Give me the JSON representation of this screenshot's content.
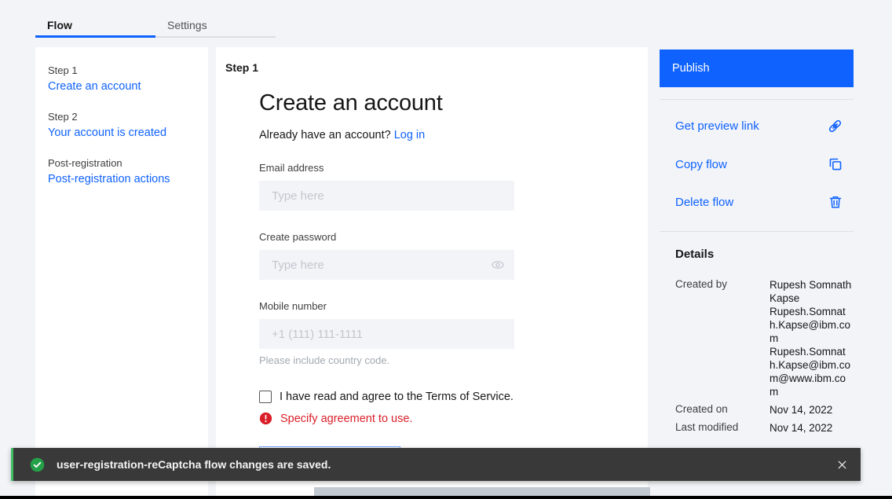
{
  "tabs": {
    "flow": "Flow",
    "settings": "Settings"
  },
  "sidebar": {
    "items": [
      {
        "label": "Step 1",
        "link": "Create an account"
      },
      {
        "label": "Step 2",
        "link": "Your account is created"
      },
      {
        "label": "Post-registration",
        "link": "Post-registration actions"
      }
    ]
  },
  "main": {
    "step_label": "Step 1",
    "title": "Create an account",
    "subtitle": "Already have an account?",
    "login_link": "Log in",
    "fields": {
      "email": {
        "label": "Email address",
        "placeholder": "Type here"
      },
      "password": {
        "label": "Create password",
        "placeholder": "Type here"
      },
      "mobile": {
        "label": "Mobile number",
        "placeholder": "+1 (111) 111-1111",
        "helper": "Please include country code."
      }
    },
    "terms_label": "I have read and agree to the Terms of Service.",
    "error_message": "Specify agreement to use."
  },
  "rail": {
    "publish": "Publish",
    "actions": [
      {
        "label": "Get preview link",
        "icon": "link-icon"
      },
      {
        "label": "Copy flow",
        "icon": "copy-icon"
      },
      {
        "label": "Delete flow",
        "icon": "trash-icon"
      }
    ],
    "details": {
      "heading": "Details",
      "created_by_label": "Created by",
      "created_by_name": "Rupesh Somnath Kapse",
      "created_by_email": "Rupesh.Somnath.Kapse@ibm.com",
      "created_by_upn": "Rupesh.Somnath.Kapse@ibm.com@www.ibm.com",
      "created_on_label": "Created on",
      "created_on_value": "Nov 14, 2022",
      "last_modified_label": "Last modified",
      "last_modified_value": "Nov 14, 2022"
    }
  },
  "toast": {
    "message": "user-registration-reCaptcha flow changes are saved."
  },
  "colors": {
    "accent": "#0f62fe",
    "success_dark": "#24a148",
    "success_light": "#42be65",
    "error": "#da1e28",
    "toast_bg": "#393939"
  }
}
